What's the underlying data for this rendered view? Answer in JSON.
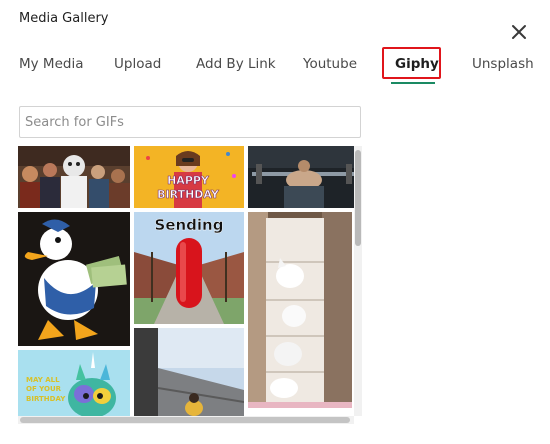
{
  "dialog": {
    "title": "Media Gallery",
    "close_icon": "close-icon"
  },
  "tabs": [
    {
      "label": "My Media",
      "active": false
    },
    {
      "label": "Upload",
      "active": false
    },
    {
      "label": "Add By Link",
      "active": false
    },
    {
      "label": "Youtube",
      "active": false
    },
    {
      "label": "Giphy",
      "active": true
    },
    {
      "label": "Unsplash",
      "active": false
    }
  ],
  "search": {
    "placeholder": "Search for GIFs",
    "value": ""
  },
  "gifs": [
    {
      "name": "crowd-costume-gif"
    },
    {
      "name": "happy-birthday-gif",
      "text_line1": "HAPPY",
      "text_line2": "BIRTHDAY"
    },
    {
      "name": "weightlifting-gif"
    },
    {
      "name": "donald-duck-money-gif"
    },
    {
      "name": "sending-pill-gif",
      "text": "Sending"
    },
    {
      "name": "cats-shelf-gif"
    },
    {
      "name": "birthday-cat-gif",
      "text_line1": "MAY ALL",
      "text_line2": "OF YOUR",
      "text_line3": "BIRTHDAY"
    },
    {
      "name": "balcony-video-gif"
    }
  ],
  "colors": {
    "accent_underline": "#1a8a63",
    "highlight_border": "#e0151b"
  }
}
